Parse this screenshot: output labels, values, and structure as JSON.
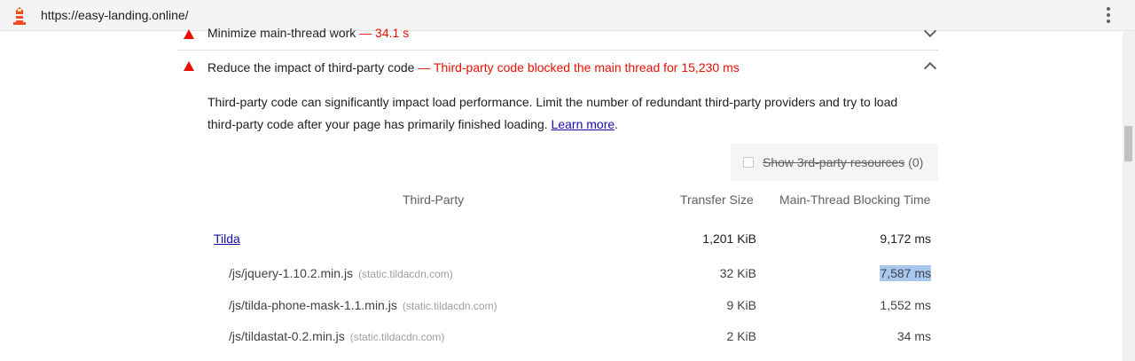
{
  "browser": {
    "url": "https://easy-landing.online/",
    "lighthouse_icon": "lighthouse-icon",
    "menu_icon": "kebab-menu-icon"
  },
  "audits": [
    {
      "title": "Minimize main-thread work",
      "display_value": "— 34.1 s",
      "status": "fail",
      "expanded": false
    },
    {
      "title": "Reduce the impact of third-party code",
      "display_value": "— Third-party code blocked the main thread for 15,230 ms",
      "status": "fail",
      "expanded": true
    }
  ],
  "third_party": {
    "description": "Third-party code can significantly impact load performance. Limit the number of redundant third-party providers and try to load third-party code after your page has primarily finished loading.",
    "learn_more": "Learn more",
    "description_end": ".",
    "filter": {
      "label": "Show 3rd-party resources",
      "count": "(0)",
      "checked": false
    },
    "columns": {
      "entity": "Third-Party",
      "transfer": "Transfer Size",
      "blocking": "Main-Thread Blocking Time"
    },
    "entity": {
      "name": "Tilda",
      "transfer": "1,201 KiB",
      "blocking": "9,172 ms"
    },
    "rows": [
      {
        "url": "/js/jquery-1.10.2.min.js",
        "host": "(static.tildacdn.com)",
        "transfer": "32 KiB",
        "blocking": "7,587 ms",
        "highlighted": true
      },
      {
        "url": "/js/tilda-phone-mask-1.1.min.js",
        "host": "(static.tildacdn.com)",
        "transfer": "9 KiB",
        "blocking": "1,552 ms",
        "highlighted": false
      },
      {
        "url": "/js/tildastat-0.2.min.js",
        "host": "(static.tildacdn.com)",
        "transfer": "2 KiB",
        "blocking": "34 ms",
        "highlighted": false
      }
    ]
  },
  "colors": {
    "fail": "#eb0f00",
    "link": "#1a0dab",
    "highlight": "#a8c8f0"
  }
}
